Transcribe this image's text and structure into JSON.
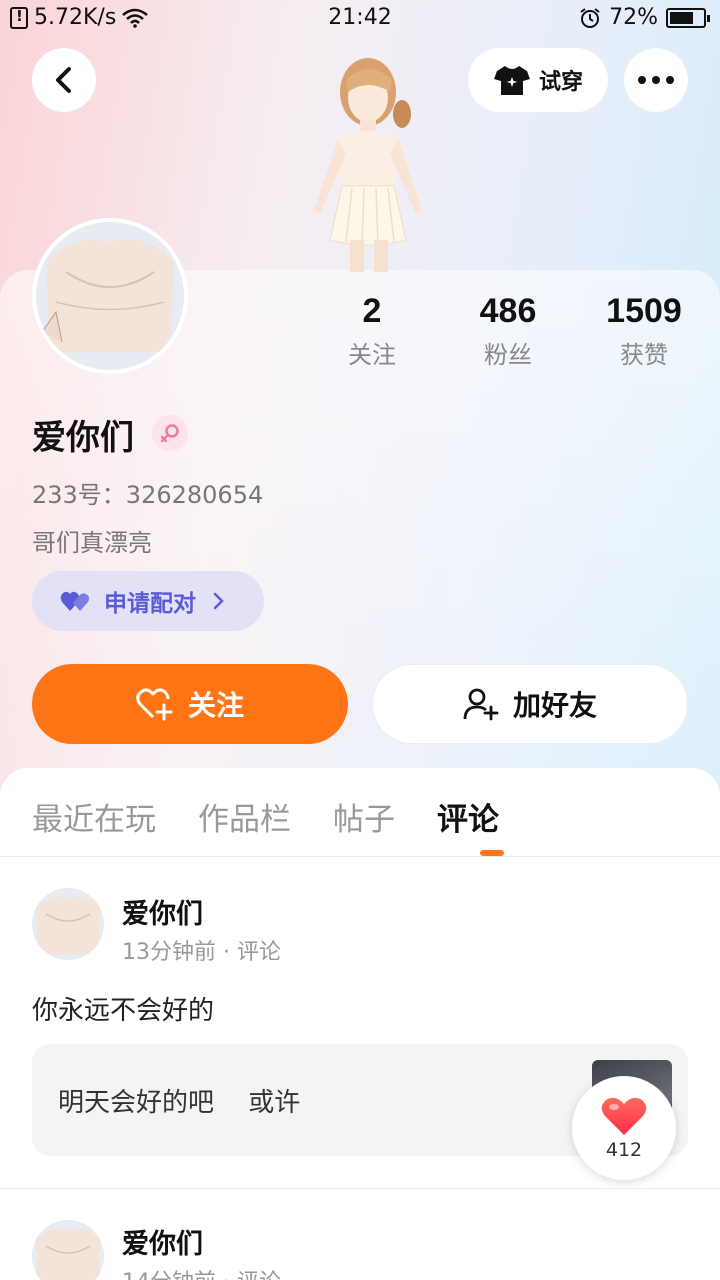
{
  "status_bar": {
    "net_speed": "5.72K/s",
    "time": "21:42",
    "battery": "72%",
    "battery_level": 0.72
  },
  "header": {
    "try_on_label": "试穿"
  },
  "stats": [
    {
      "num": "2",
      "label": "关注"
    },
    {
      "num": "486",
      "label": "粉丝"
    },
    {
      "num": "1509",
      "label": "获赞"
    }
  ],
  "profile": {
    "name": "爱你们",
    "gender": "female",
    "uid": "233号：326280654",
    "bio": "哥们真漂亮",
    "pair_label": "申请配对"
  },
  "actions": {
    "follow_label": "关注",
    "add_friend_label": "加好友"
  },
  "tabs": [
    "最近在玩",
    "作品栏",
    "帖子",
    "评论"
  ],
  "active_tab": "评论",
  "posts": [
    {
      "name": "爱你们",
      "meta": "13分钟前 · 评论",
      "text": "你永远不会好的",
      "quote": "明天会好的吧　 或许"
    },
    {
      "name": "爱你们",
      "meta": "14分钟前 · 评论"
    }
  ],
  "like_bubble": {
    "count": "412"
  },
  "colors": {
    "accent": "#ff7414",
    "pair_text": "#5b5bd6",
    "pair_bg": "#e3e1f6",
    "like": "#ff3b3b"
  }
}
